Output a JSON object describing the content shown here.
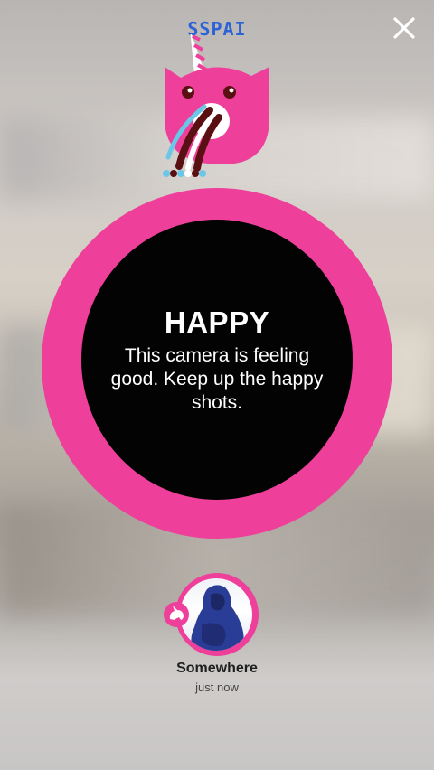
{
  "header": {
    "watermark": "SSPAI",
    "close_icon": "close-icon"
  },
  "mascot": {
    "icon": "unicorn-cat-mascot",
    "colors": {
      "body": "#ee3f9a",
      "stripe_dark": "#5a0f12",
      "stripe_light": "#ffffff",
      "stripe_blue": "#6bc7e8"
    }
  },
  "mood": {
    "title": "HAPPY",
    "description": "This camera is feeling good. Keep up the happy shots.",
    "ring_color": "#ee3f9a"
  },
  "post": {
    "location": "Somewhere",
    "time": "just now",
    "badge_icon": "unicorn-badge-icon"
  }
}
